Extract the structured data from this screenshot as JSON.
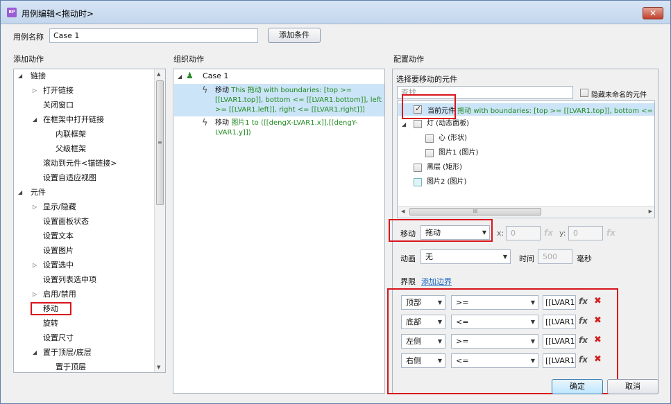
{
  "window": {
    "title": "用例编辑<拖动时>",
    "close_label": "✕",
    "app_icon": "RP"
  },
  "case": {
    "name_label": "用例名称",
    "name_value": "Case 1",
    "add_condition": "添加条件"
  },
  "left": {
    "header": "添加动作",
    "items": [
      {
        "label": "链接"
      },
      {
        "label": "打开链接"
      },
      {
        "label": "关闭窗口"
      },
      {
        "label": "在框架中打开链接"
      },
      {
        "label": "内联框架"
      },
      {
        "label": "父级框架"
      },
      {
        "label": "滚动到元件<锚链接>"
      },
      {
        "label": "设置自适应视图"
      },
      {
        "label": "元件"
      },
      {
        "label": "显示/隐藏"
      },
      {
        "label": "设置面板状态"
      },
      {
        "label": "设置文本"
      },
      {
        "label": "设置图片"
      },
      {
        "label": "设置选中"
      },
      {
        "label": "设置列表选中项"
      },
      {
        "label": "启用/禁用"
      },
      {
        "label": "移动"
      },
      {
        "label": "旋转"
      },
      {
        "label": "设置尺寸"
      },
      {
        "label": "置于顶层/底层"
      },
      {
        "label": "置于顶层"
      }
    ]
  },
  "middle": {
    "header": "组织动作",
    "case_label": "Case 1",
    "action1": {
      "prefix": "移动",
      "text": "This 拖动 with boundaries: [top >= [[LVAR1.top]], bottom <= [[LVAR1.bottom]], left >= [[LVAR1.left]], right <= [[LVAR1.right]]]"
    },
    "action2": {
      "prefix": "移动",
      "text": "图片1 to ([[dengX-LVAR1.x]],[[dengY-LVAR1.y]])"
    }
  },
  "right": {
    "header": "配置动作",
    "select_label": "选择要移动的元件",
    "search_placeholder": "查找",
    "hide_unnamed": "隐藏未命名的元件",
    "widgets": [
      {
        "label": "当前元件",
        "detail": "拖动 with boundaries: [top >= [[LVAR1.top]], bottom <= [[LVAR1",
        "checked": true
      },
      {
        "label": "灯 (动态面板)",
        "checked": false
      },
      {
        "label": "心 (形状)",
        "checked": false
      },
      {
        "label": "图片1 (图片)",
        "checked": false
      },
      {
        "label": "黑层 (矩形)",
        "checked": false
      },
      {
        "label": "图片2 (图片)",
        "checked": false
      }
    ],
    "move_label": "移动",
    "move_value": "拖动",
    "x_label": "x:",
    "x_value": "0",
    "y_label": "y:",
    "y_value": "0",
    "fx": "fx",
    "anim_label": "动画",
    "anim_value": "无",
    "time_label": "时间",
    "time_value": "500",
    "ms_label": "毫秒",
    "bounds_label": "界限",
    "add_bound": "添加边界",
    "bounds": [
      {
        "side": "顶部",
        "op": ">=",
        "value": "[[LVAR1."
      },
      {
        "side": "底部",
        "op": "<=",
        "value": "[[LVAR1."
      },
      {
        "side": "左侧",
        "op": ">=",
        "value": "[[LVAR1."
      },
      {
        "side": "右侧",
        "op": "<=",
        "value": "[[LVAR1."
      }
    ],
    "delete_icon": "✖"
  },
  "footer": {
    "ok": "确定",
    "cancel": "取消"
  },
  "scroll": {
    "thumb_grip": "≡",
    "hthumb_grip": "III"
  }
}
